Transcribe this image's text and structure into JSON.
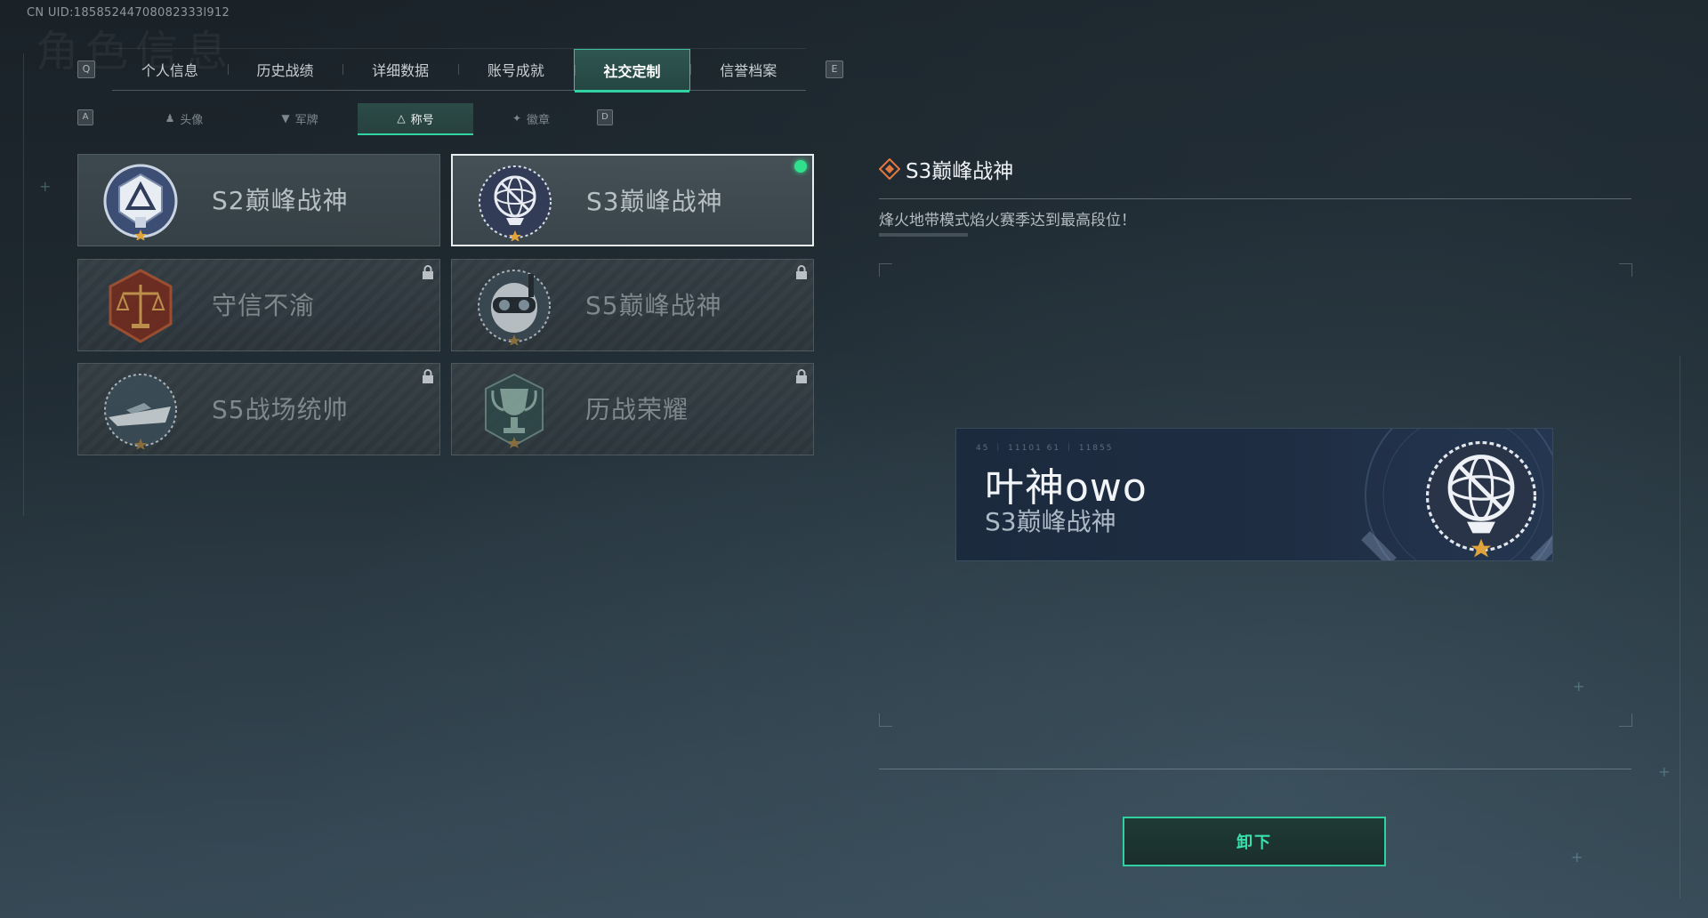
{
  "uid": "CN UID:18585244708082333l912",
  "ghost_title": "角色信息",
  "top_nav": {
    "left_key": "Q",
    "right_key": "E",
    "tabs": [
      {
        "label": "个人信息"
      },
      {
        "label": "历史战绩"
      },
      {
        "label": "详细数据"
      },
      {
        "label": "账号成就"
      },
      {
        "label": "社交定制"
      },
      {
        "label": "信誉档案"
      }
    ],
    "active_index": 4
  },
  "sub_nav": {
    "left_key": "A",
    "right_key": "D",
    "tabs": [
      {
        "label": "头像",
        "icon": "person-icon"
      },
      {
        "label": "军牌",
        "icon": "dogtag-icon"
      },
      {
        "label": "称号",
        "icon": "title-icon"
      },
      {
        "label": "徽章",
        "icon": "badge-icon"
      }
    ],
    "active_index": 2
  },
  "titles": [
    {
      "label": "S2巅峰战神",
      "emblem": "s2-shield-emblem",
      "state": "unlocked"
    },
    {
      "label": "S3巅峰战神",
      "emblem": "armillary-globe-emblem",
      "state": "equipped"
    },
    {
      "label": "守信不渝",
      "emblem": "scales-emblem",
      "state": "locked"
    },
    {
      "label": "S5巅峰战神",
      "emblem": "diving-mask-emblem",
      "state": "locked"
    },
    {
      "label": "S5战场统帅",
      "emblem": "speedboat-emblem",
      "state": "locked"
    },
    {
      "label": "历战荣耀",
      "emblem": "trophy-emblem",
      "state": "locked"
    }
  ],
  "detail": {
    "title": "S3巅峰战神",
    "description": "烽火地带模式焰火赛季达到最高段位！"
  },
  "namecard": {
    "code": "45 ｜ 11101   61 ｜ 11855",
    "player_name": "叶神owo",
    "title": "S3巅峰战神"
  },
  "action_button": "卸下",
  "colors": {
    "accent": "#32d3a2",
    "equipped_dot": "#31e08c",
    "detail_icon": "#e3773f"
  }
}
